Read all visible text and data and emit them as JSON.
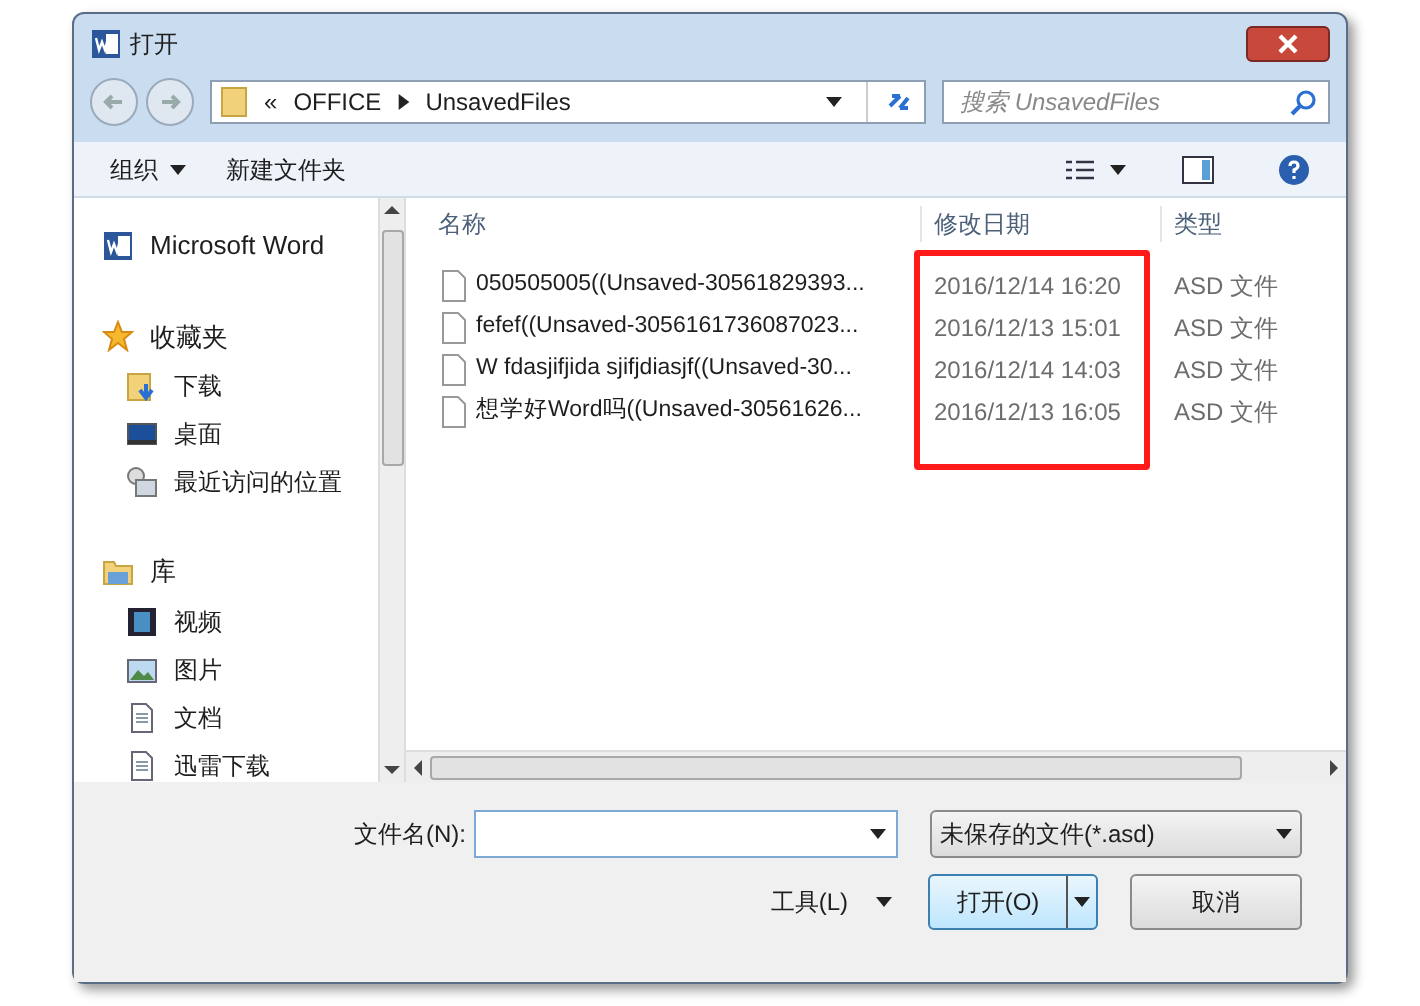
{
  "window": {
    "title": "打开"
  },
  "address": {
    "path": [
      "«",
      "OFFICE",
      "UnsavedFiles"
    ],
    "search_placeholder": "搜索 UnsavedFiles"
  },
  "toolbar": {
    "organize": "组织",
    "new_folder": "新建文件夹"
  },
  "sidebar": {
    "items": [
      {
        "kind": "section",
        "label": "Microsoft Word"
      },
      {
        "kind": "section",
        "label": "收藏夹",
        "children": [
          {
            "label": "下载"
          },
          {
            "label": "桌面"
          },
          {
            "label": "最近访问的位置"
          }
        ]
      },
      {
        "kind": "section",
        "label": "库",
        "children": [
          {
            "label": "视频"
          },
          {
            "label": "图片"
          },
          {
            "label": "文档"
          },
          {
            "label": "迅雷下载"
          }
        ]
      }
    ]
  },
  "table": {
    "columns": [
      "名称",
      "修改日期",
      "类型"
    ],
    "rows": [
      {
        "name": "050505005((Unsaved-30561829393...",
        "date": "2016/12/14 16:20",
        "type": "ASD 文件"
      },
      {
        "name": "fefef((Unsaved-3056161736087023...",
        "date": "2016/12/13 15:01",
        "type": "ASD 文件"
      },
      {
        "name": "W fdasjifjida sjifjdiasjf((Unsaved-30...",
        "date": "2016/12/14 14:03",
        "type": "ASD 文件"
      },
      {
        "name": "想学好Word吗((Unsaved-30561626...",
        "date": "2016/12/13 16:05",
        "type": "ASD 文件"
      }
    ]
  },
  "footer": {
    "filename_label": "文件名(N):",
    "filetype": "未保存的文件(*.asd)",
    "tools": "工具(L)",
    "open": "打开(O)",
    "cancel": "取消"
  }
}
